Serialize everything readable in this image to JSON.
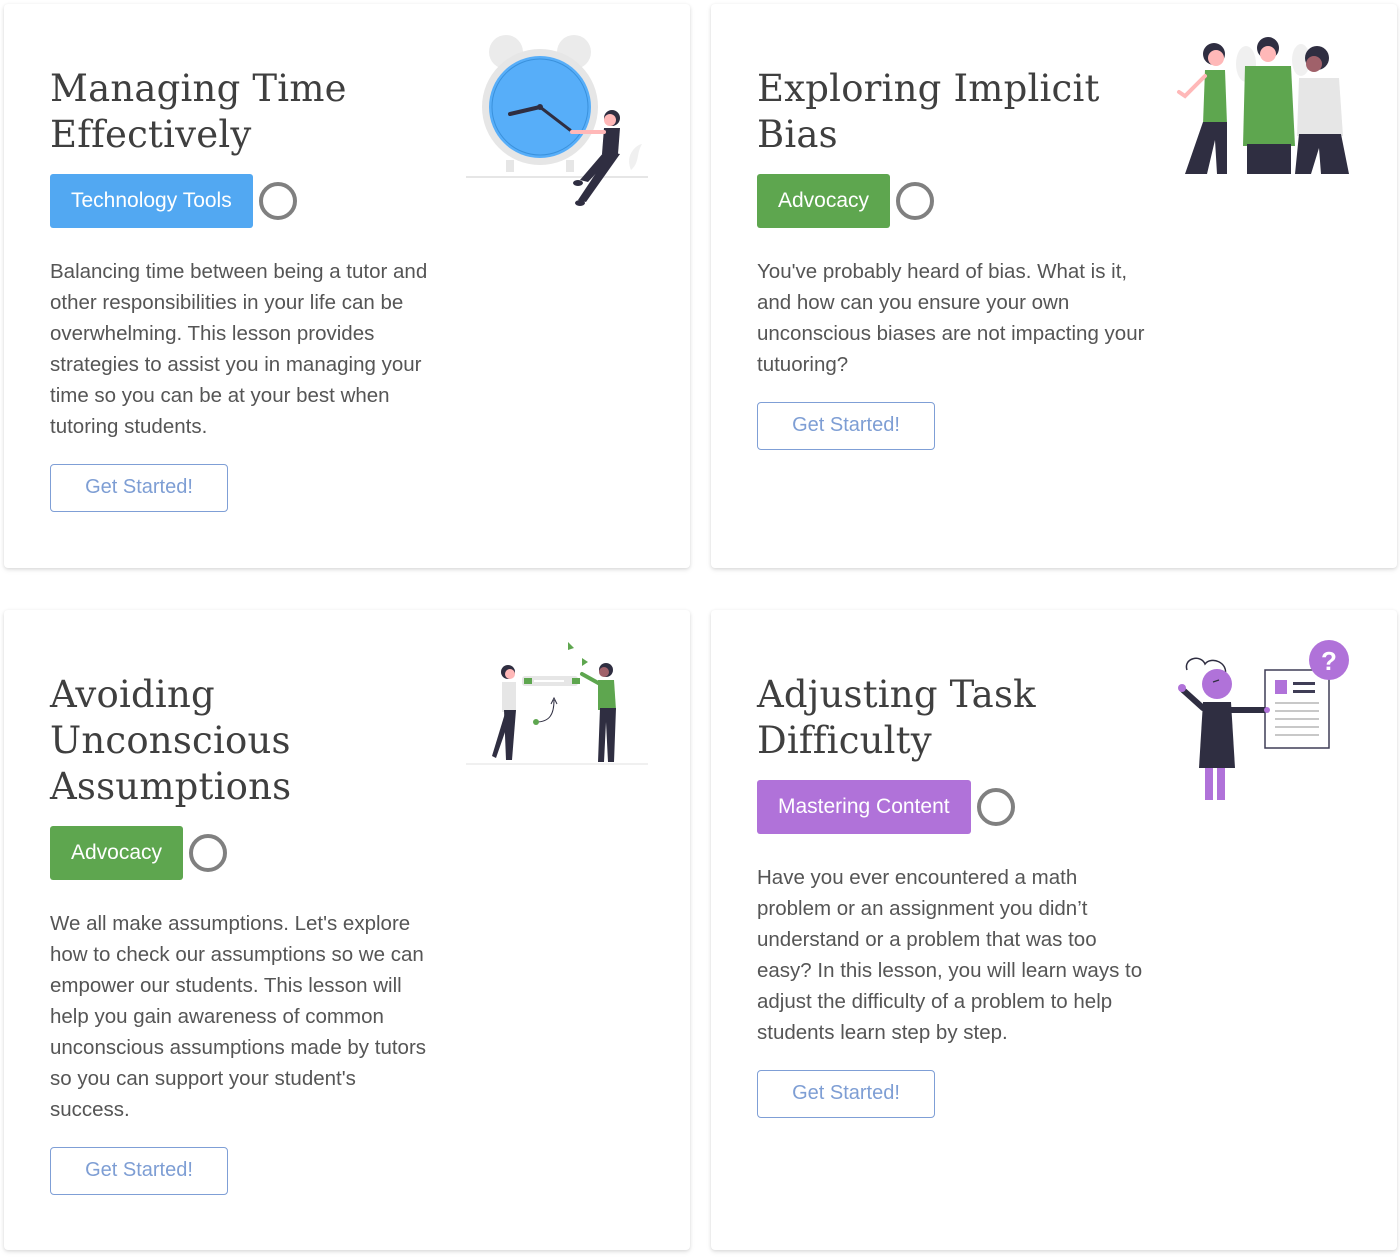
{
  "colors": {
    "technology_tools": "#52a8f2",
    "advocacy": "#5ea64f",
    "mastering_content": "#b072d9",
    "button_border": "#7f9fd6",
    "button_text": "#7e9ed4",
    "title_text": "#3f3f3f",
    "body_text": "#555555",
    "status_circle": "#808080"
  },
  "cards": [
    {
      "title": "Managing Time Effectively",
      "tag": "Technology Tools",
      "tag_color": "#52a8f2",
      "description": "Balancing time between being a tutor and other responsibilities in your life can be overwhelming. This lesson provides strategies to assist you in managing your time so you can be at your best when tutoring students.",
      "button": "Get Started!",
      "illustration": "person-with-clock-illustration",
      "status_icon": "incomplete-circle-icon"
    },
    {
      "title": "Exploring Implicit Bias",
      "tag": "Advocacy",
      "tag_color": "#5ea64f",
      "description": "You've probably heard of bias. What is it, and how can you ensure your own unconscious biases are not impacting your tutuoring?",
      "button": "Get Started!",
      "illustration": "three-people-illustration",
      "status_icon": "incomplete-circle-icon"
    },
    {
      "title": "Avoiding Unconscious Assumptions",
      "tag": "Advocacy",
      "tag_color": "#5ea64f",
      "description": "We all make assumptions. Let's explore how to check our assumptions so we can empower our students. This lesson will help you gain awareness of common unconscious assumptions made by tutors so you can support your student's success.",
      "button": "Get Started!",
      "illustration": "two-people-collaborating-illustration",
      "status_icon": "incomplete-circle-icon"
    },
    {
      "title": "Adjusting Task Difficulty",
      "tag": "Mastering Content",
      "tag_color": "#b072d9",
      "description": "Have you ever encountered a math problem or an assignment you didn’t understand or a problem that was too easy? In this lesson, you will learn ways to adjust the difficulty of a problem to help students learn step by step.",
      "button": "Get Started!",
      "illustration": "person-with-question-document-illustration",
      "status_icon": "incomplete-circle-icon"
    }
  ]
}
